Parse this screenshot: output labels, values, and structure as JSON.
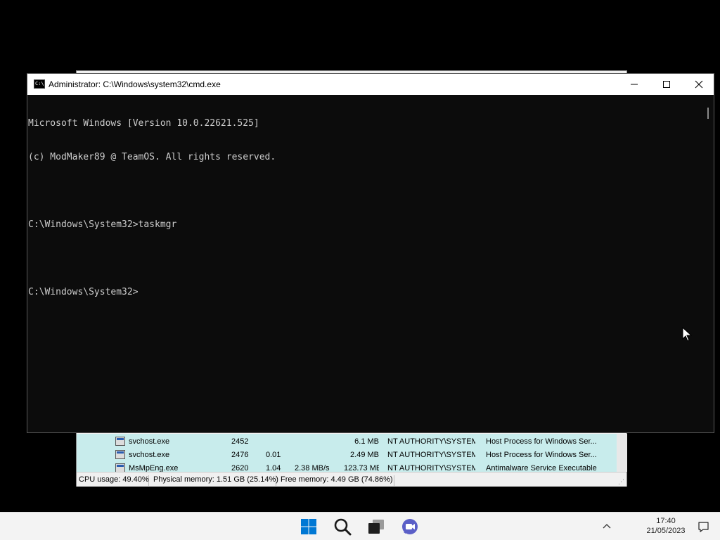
{
  "task_manager": {
    "rows": [
      {
        "name": "svchost.exe",
        "pid": "2452",
        "cpu": "",
        "io": "",
        "memory": "6.1 MB",
        "user": "NT AUTHORITY\\SYSTEM",
        "description": "Host Process for Windows Ser..."
      },
      {
        "name": "svchost.exe",
        "pid": "2476",
        "cpu": "0.01",
        "io": "",
        "memory": "2.49 MB",
        "user": "NT AUTHORITY\\SYSTEM",
        "description": "Host Process for Windows Ser..."
      },
      {
        "name": "MsMpEng.exe",
        "pid": "2620",
        "cpu": "1.04",
        "io": "2.38 MB/s",
        "memory": "123.73 MB",
        "user": "NT AUTHORITY\\SYSTEM",
        "description": "Antimalware Service Executable"
      }
    ],
    "status": {
      "cpu_usage": "CPU usage: 49.40%",
      "physical_memory": "Physical memory: 1.51 GB (25.14%)",
      "free_memory": "Free memory: 4.49 GB (74.86%)"
    }
  },
  "cmd_window": {
    "title": "Administrator: C:\\Windows\\system32\\cmd.exe",
    "icon_text": "C:\\",
    "console_lines": [
      "Microsoft Windows [Version 10.0.22621.525]",
      "(c) ModMaker89 @ TeamOS. All rights reserved.",
      "",
      "C:\\Windows\\System32>taskmgr",
      "",
      "C:\\Windows\\System32>"
    ]
  },
  "taskbar": {
    "icons": [
      "windows-start-icon",
      "search-icon",
      "task-view-icon",
      "teams-chat-icon"
    ],
    "clock_time": "17:40",
    "clock_date": "21/05/2023"
  },
  "colors": {
    "console_bg": "#0c0c0c",
    "console_fg": "#cccccc",
    "highlight_rows": "#c8ecec",
    "start_blue": "#0078d4",
    "chat_purple": "#5b5fc7"
  }
}
